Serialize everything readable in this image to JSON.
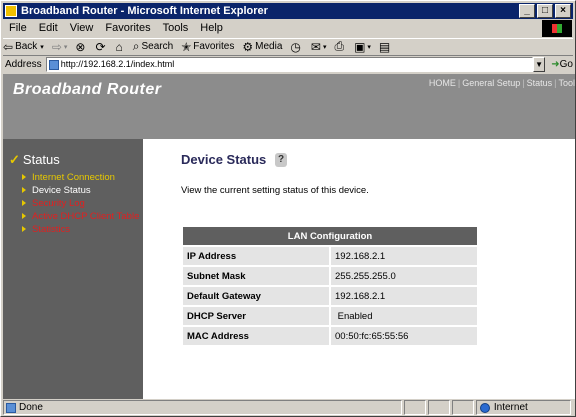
{
  "window": {
    "title": "Broadband Router - Microsoft Internet Explorer",
    "controls": [
      "_",
      "□",
      "×"
    ]
  },
  "menu": [
    "File",
    "Edit",
    "View",
    "Favorites",
    "Tools",
    "Help"
  ],
  "toolbar": {
    "back": "Back",
    "search": "Search",
    "favorites": "Favorites",
    "media": "Media"
  },
  "address": {
    "label": "Address",
    "url": "http://192.168.2.1/index.html",
    "go": "Go"
  },
  "banner": {
    "brand": "Broadband Router",
    "nav": [
      "HOME",
      "General Setup",
      "Status",
      "Tool"
    ]
  },
  "sidebar": {
    "heading": "Status",
    "items": [
      {
        "label": "Internet Connection",
        "color": "#e6c800"
      },
      {
        "label": "Device Status",
        "color": "#ffffff"
      },
      {
        "label": "Security Log",
        "color": "#e02020"
      },
      {
        "label": "Active DHCP Client Table",
        "color": "#e02020"
      },
      {
        "label": "Statistics",
        "color": "#e02020"
      }
    ]
  },
  "main": {
    "title": "Device Status",
    "help_glyph": "?",
    "description": "View the current setting status of this device.",
    "table": {
      "header": "LAN Configuration",
      "rows": [
        {
          "key": "IP Address",
          "value": "192.168.2.1"
        },
        {
          "key": "Subnet Mask",
          "value": "255.255.255.0"
        },
        {
          "key": "Default Gateway",
          "value": "192.168.2.1"
        },
        {
          "key": "DHCP Server",
          "value": " Enabled"
        },
        {
          "key": "MAC Address",
          "value": "00:50:fc:65:55:56"
        }
      ]
    }
  },
  "status": {
    "text": "Done",
    "zone": "Internet"
  }
}
